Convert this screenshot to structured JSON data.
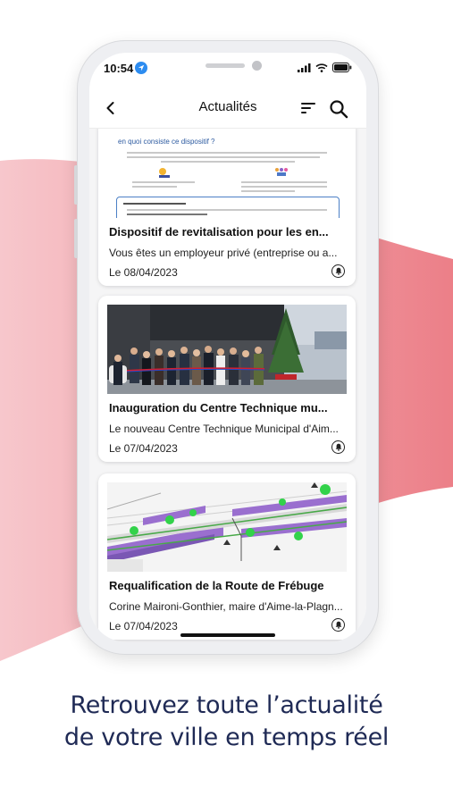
{
  "status_bar": {
    "time": "10:54"
  },
  "nav": {
    "title": "Actualités"
  },
  "icons": {
    "back": "chevron-left-icon",
    "filter": "filter-lines-icon",
    "search": "search-icon",
    "bell": "bell-icon",
    "location": "location-arrow-icon"
  },
  "articles": [
    {
      "title": "Dispositif de revitalisation pour les en...",
      "summary": "Vous êtes un employeur privé (entreprise ou a...",
      "date": "Le 08/04/2023",
      "image_heading": "en quoi consiste ce dispositif ?"
    },
    {
      "title": "Inauguration du Centre Technique mu...",
      "summary": "Le nouveau Centre Technique Municipal d'Aim...",
      "date": "Le 07/04/2023"
    },
    {
      "title": "Requalification de la Route de Frébuge",
      "summary": "Corine Maironi-Gonthier, maire d'Aime-la-Plagn...",
      "date": "Le 07/04/2023"
    }
  ],
  "tagline": {
    "line1": "Retrouvez toute l’actualité",
    "line2": "de votre ville en temps réel"
  },
  "colors": {
    "accent": "#e5707c",
    "tagline": "#1f2a55",
    "location": "#2d8cf0"
  }
}
